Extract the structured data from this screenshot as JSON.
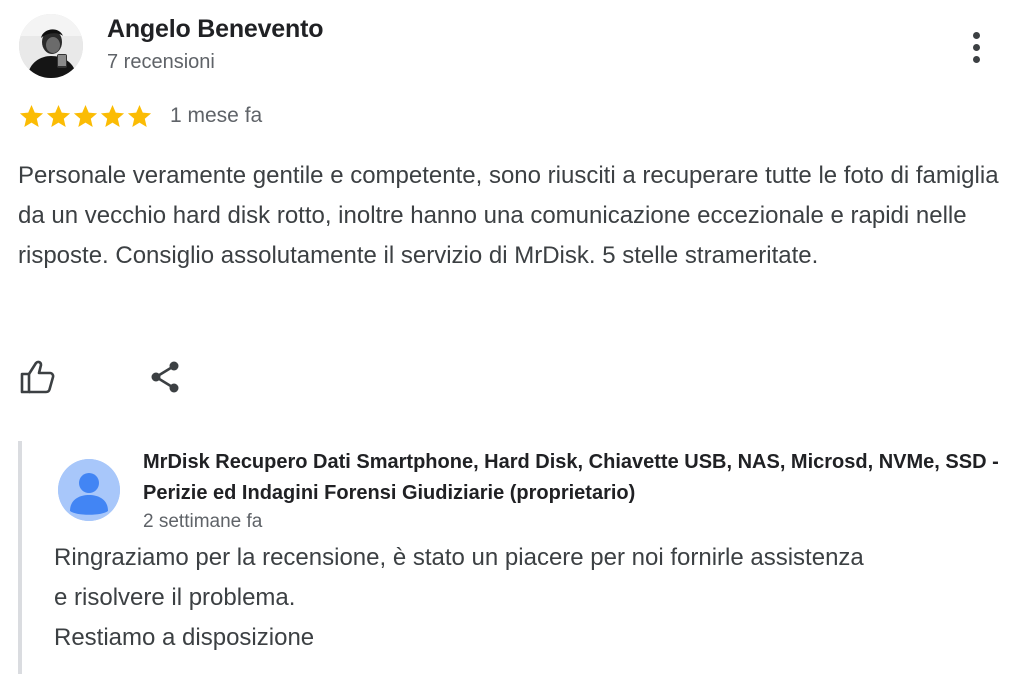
{
  "review": {
    "author": {
      "name": "Angelo Benevento",
      "review_count": "7 recensioni",
      "avatar_icon": "user-photo-avatar"
    },
    "rating": {
      "value": 5,
      "max": 5,
      "star_color": "#fbbc04"
    },
    "date": "1 mese fa",
    "text": "Personale veramente gentile e competente, sono riusciti a recuperare tutte le foto di famiglia da un vecchio hard disk rotto, inoltre hanno una comunicazione eccezionale e rapidi nelle risposte. Consiglio assolutamente il servizio di MrDisk. 5 stelle strameritate.",
    "actions": {
      "like_icon": "thumb-up-icon",
      "share_icon": "share-icon",
      "more_icon": "more-vert-icon"
    }
  },
  "reply": {
    "owner_name": "MrDisk Recupero Dati Smartphone, Hard Disk, Chiavette USB, NAS, Microsd, NVMe, SSD - Perizie ed Indagini Forensi Giudiziarie (proprietario)",
    "date": "2 settimane fa",
    "lines": [
      "Ringraziamo per la recensione, è stato un piacere per noi fornirle assistenza",
      "e risolvere il problema.",
      "Restiamo a disposizione"
    ],
    "avatar_icon": "default-person-avatar",
    "avatar_color": "#a8c7fa",
    "avatar_figure_color": "#4285f4",
    "border_color": "#dadce0"
  }
}
